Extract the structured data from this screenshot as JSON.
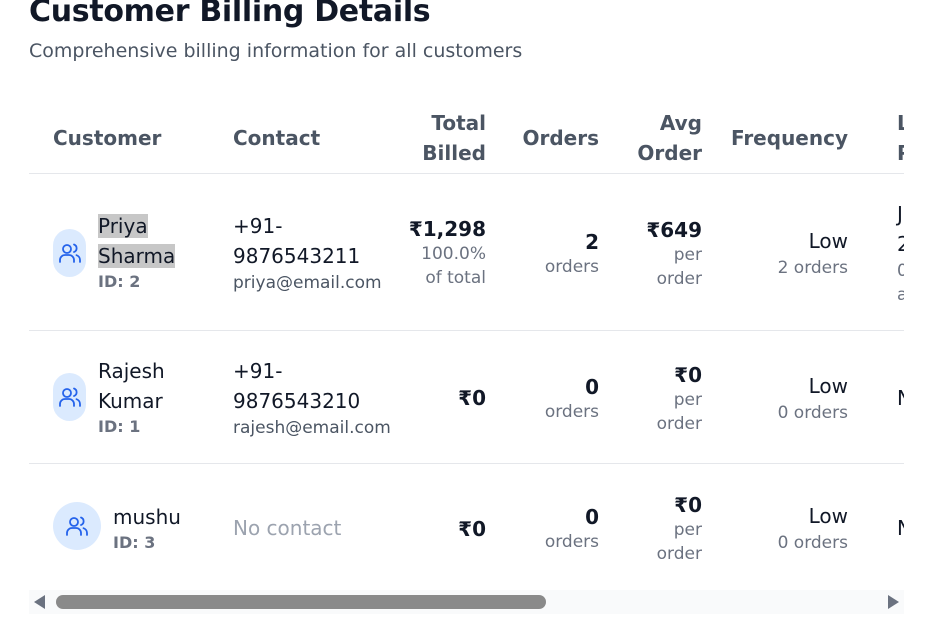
{
  "page": {
    "title": "Customer Billing Details",
    "subtitle": "Comprehensive billing information for all customers"
  },
  "table": {
    "headers": {
      "customer": "Customer",
      "contact": "Contact",
      "total_line1": "Total",
      "total_line2": "Billed",
      "orders": "Orders",
      "avg_line1": "Avg",
      "avg_line2": "Order",
      "frequency": "Frequency",
      "last_clip1": "L",
      "last_clip2": "P"
    },
    "rows": [
      {
        "name_line1": "Priya",
        "name_line2": "Sharma",
        "id": "ID: 2",
        "phone_line1": "+91-",
        "phone_line2": "9876543211",
        "email": "priya@email.com",
        "total": "₹1,298",
        "total_pct": "100.0%",
        "total_of": "of total",
        "orders": "2",
        "orders_label": "orders",
        "avg": "₹649",
        "avg_per": "per",
        "avg_order": "order",
        "frequency": "Low",
        "frequency_sub": "2 orders",
        "last_clip1": "J",
        "last_clip2": "2",
        "last_clip3": "0",
        "last_clip4": "a"
      },
      {
        "name_line1": "Rajesh",
        "name_line2": "Kumar",
        "id": "ID: 1",
        "phone_line1": "+91-",
        "phone_line2": "9876543210",
        "email": "rajesh@email.com",
        "total": "₹0",
        "orders": "0",
        "orders_label": "orders",
        "avg": "₹0",
        "avg_per": "per",
        "avg_order": "order",
        "frequency": "Low",
        "frequency_sub": "0 orders",
        "last_clip1": "N"
      },
      {
        "name": "mushu",
        "id": "ID: 3",
        "contact": "No contact",
        "total": "₹0",
        "orders": "0",
        "orders_label": "orders",
        "avg": "₹0",
        "avg_per": "per",
        "avg_order": "order",
        "frequency": "Low",
        "frequency_sub": "0 orders",
        "last_clip1": "N"
      }
    ]
  },
  "icons": {
    "avatar": "users-icon",
    "scroll_left": "triangle-left-icon",
    "scroll_right": "triangle-right-icon"
  },
  "colors": {
    "avatar_bg": "#dbeafe",
    "avatar_icon": "#2563eb",
    "selection": "#c7c7c7"
  },
  "scroll": {
    "horizontal_position": 0,
    "thumb_fraction": 0.58
  }
}
